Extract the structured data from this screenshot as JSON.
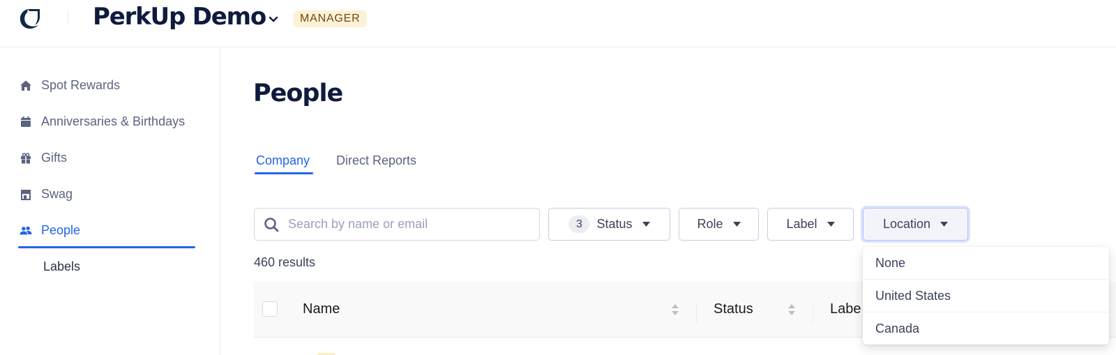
{
  "header": {
    "org_name": "PerkUp Demo",
    "role_badge": "MANAGER",
    "icons": {
      "logo": "perkup-logo",
      "org_menu": "chevron-down-icon"
    }
  },
  "sidebar": {
    "items": [
      {
        "label": "Spot Rewards",
        "icon": "home-icon",
        "active": false
      },
      {
        "label": "Anniversaries & Birthdays",
        "icon": "calendar-icon",
        "active": false
      },
      {
        "label": "Gifts",
        "icon": "gift-icon",
        "active": false
      },
      {
        "label": "Swag",
        "icon": "store-icon",
        "active": false
      },
      {
        "label": "People",
        "icon": "people-icon",
        "active": true
      }
    ],
    "sub_items": [
      {
        "label": "Labels"
      }
    ]
  },
  "main": {
    "title": "People",
    "tabs": [
      {
        "label": "Company",
        "active": true
      },
      {
        "label": "Direct Reports",
        "active": false
      }
    ],
    "search": {
      "placeholder": "Search by name or email",
      "value": ""
    },
    "filters": [
      {
        "label": "Status",
        "count": "3",
        "open": false
      },
      {
        "label": "Role",
        "open": false
      },
      {
        "label": "Label",
        "open": false
      },
      {
        "label": "Location",
        "open": true
      }
    ],
    "results_text": "460 results",
    "table": {
      "columns": [
        "Name",
        "Status",
        "Labels"
      ],
      "visible_columns_text": [
        "Name",
        "Status",
        "Labe"
      ]
    },
    "location_dropdown": {
      "options": [
        "None",
        "United States",
        "Canada"
      ]
    }
  },
  "colors": {
    "accent": "#2563eb",
    "brand_navy": "#0f1b3d",
    "badge_bg": "#fdf1d6",
    "badge_text": "#6b4a12",
    "nav_text": "#5b6380"
  }
}
